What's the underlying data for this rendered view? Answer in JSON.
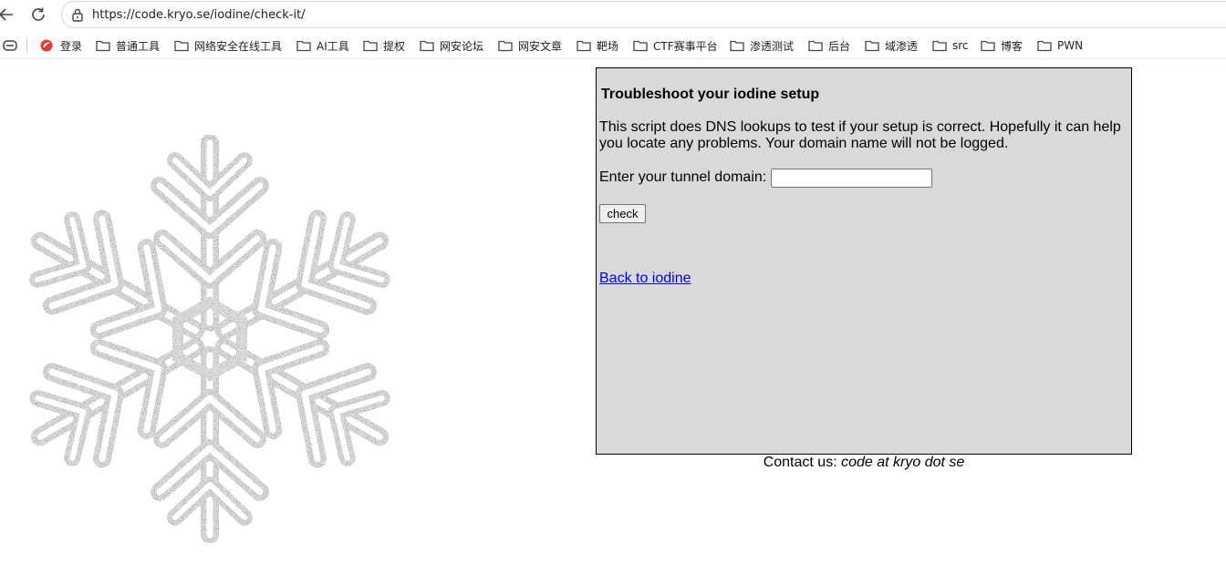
{
  "browser": {
    "url": "https://code.kryo.se/iodine/check-it/",
    "bookmarks": [
      {
        "label": "登录",
        "icon": "red-circle-icon"
      },
      {
        "label": "普通工具",
        "icon": "folder-icon"
      },
      {
        "label": "网络安全在线工具",
        "icon": "folder-icon"
      },
      {
        "label": "AI工具",
        "icon": "folder-icon"
      },
      {
        "label": "提权",
        "icon": "folder-icon"
      },
      {
        "label": "网安论坛",
        "icon": "folder-icon"
      },
      {
        "label": "网安文章",
        "icon": "folder-icon"
      },
      {
        "label": "靶场",
        "icon": "folder-icon"
      },
      {
        "label": "CTF赛事平台",
        "icon": "folder-icon"
      },
      {
        "label": "渗透测试",
        "icon": "folder-icon"
      },
      {
        "label": "后台",
        "icon": "folder-icon"
      },
      {
        "label": "域渗透",
        "icon": "folder-icon"
      },
      {
        "label": "src",
        "icon": "folder-icon"
      },
      {
        "label": "博客",
        "icon": "folder-icon"
      },
      {
        "label": "PWN",
        "icon": "folder-icon"
      }
    ]
  },
  "panel": {
    "title": "Troubleshoot your iodine setup",
    "description": "This script does DNS lookups to test if your setup is correct. Hopefully it can help you locate any problems. Your domain name will not be logged.",
    "domain_label": "Enter your tunnel domain:",
    "domain_value": "",
    "check_label": "check",
    "back_link": "Back to iodine"
  },
  "footer": {
    "contact_prefix": "Contact us:",
    "contact_email": "code at kryo dot se"
  },
  "colors": {
    "panel_bg": "#d9d9d9",
    "link": "#0000ee"
  }
}
